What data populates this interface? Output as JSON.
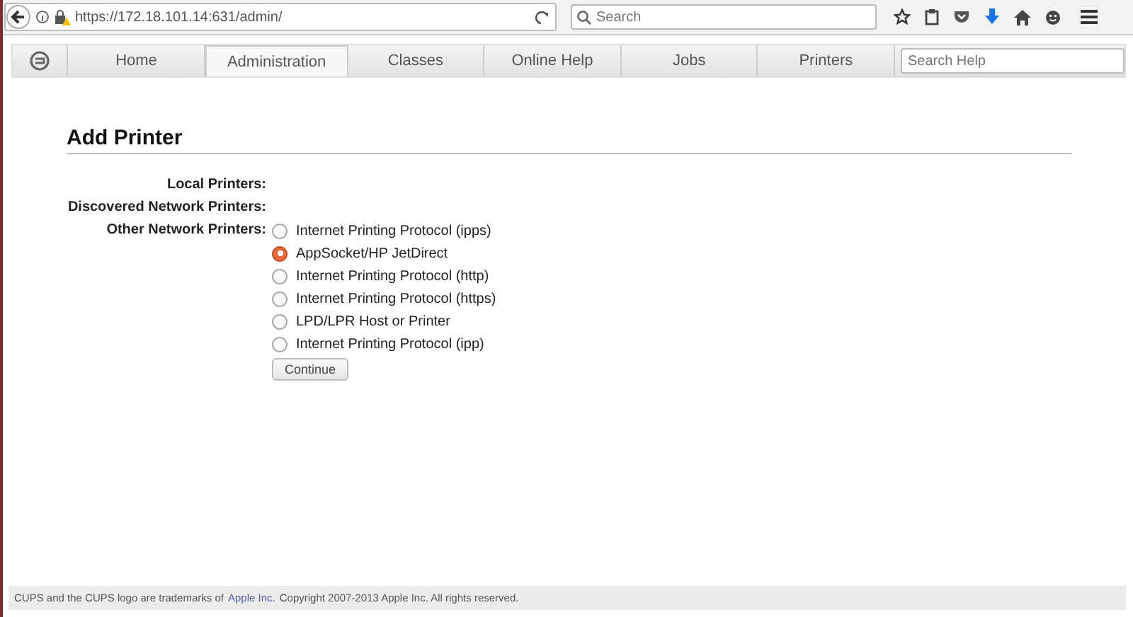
{
  "browser": {
    "url": "https://172.18.101.14:631/admin/",
    "search": {
      "placeholder": "Search"
    }
  },
  "tabs": [
    {
      "label": "Home",
      "selected": false
    },
    {
      "label": "Administration",
      "selected": true
    },
    {
      "label": "Classes",
      "selected": false
    },
    {
      "label": "Online Help",
      "selected": false
    },
    {
      "label": "Jobs",
      "selected": false
    },
    {
      "label": "Printers",
      "selected": false
    }
  ],
  "help_search": {
    "placeholder": "Search Help"
  },
  "title": "Add Printer",
  "sections": [
    {
      "label": "Local Printers:"
    },
    {
      "label": "Discovered Network Printers:"
    },
    {
      "label": "Other Network Printers:",
      "options": [
        {
          "label": "Internet Printing Protocol (ipps)",
          "selected": false
        },
        {
          "label": "AppSocket/HP JetDirect",
          "selected": true
        },
        {
          "label": "Internet Printing Protocol (http)",
          "selected": false
        },
        {
          "label": "Internet Printing Protocol (https)",
          "selected": false
        },
        {
          "label": "LPD/LPR Host or Printer",
          "selected": false
        },
        {
          "label": "Internet Printing Protocol (ipp)",
          "selected": false
        }
      ]
    }
  ],
  "continue_button": "Continue",
  "footer": {
    "before": "CUPS and the CUPS logo are trademarks of",
    "link": "Apple Inc.",
    "after": "Copyright 2007-2013 Apple Inc. All rights reserved."
  }
}
